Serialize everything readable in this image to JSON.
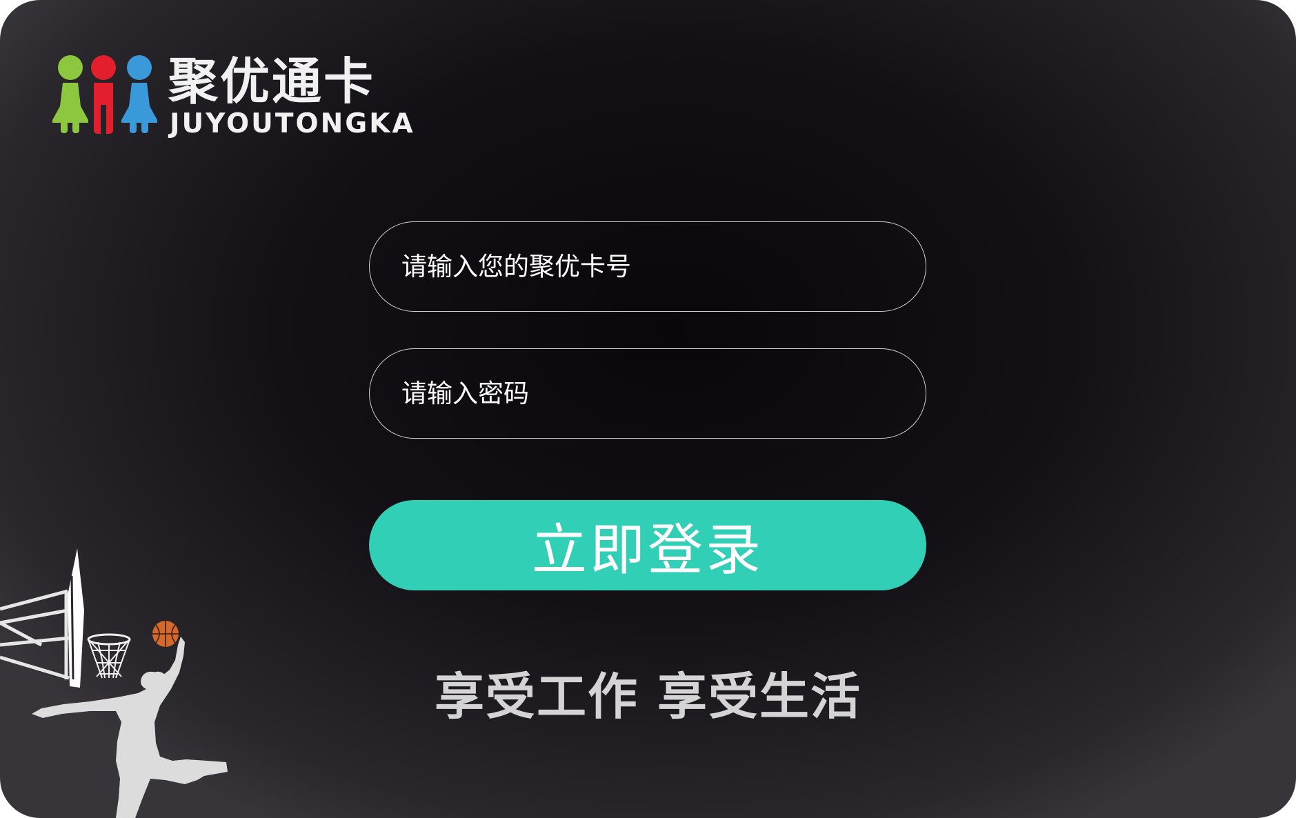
{
  "logo": {
    "name_cn": "聚优通卡",
    "name_en": "JUYOUTONGKA",
    "figure_colors": [
      "#8dc63f",
      "#e31e2d",
      "#3a99d8"
    ]
  },
  "form": {
    "card_placeholder": "请输入您的聚优卡号",
    "password_placeholder": "请输入密码",
    "login_label": "立即登录"
  },
  "slogan": "享受工作 享受生活",
  "theme": {
    "accent": "#30cfb6",
    "background": "#141116"
  },
  "decoration": {
    "illustration": "basketball-player-silhouette",
    "ball_icon": "basketball-icon"
  }
}
